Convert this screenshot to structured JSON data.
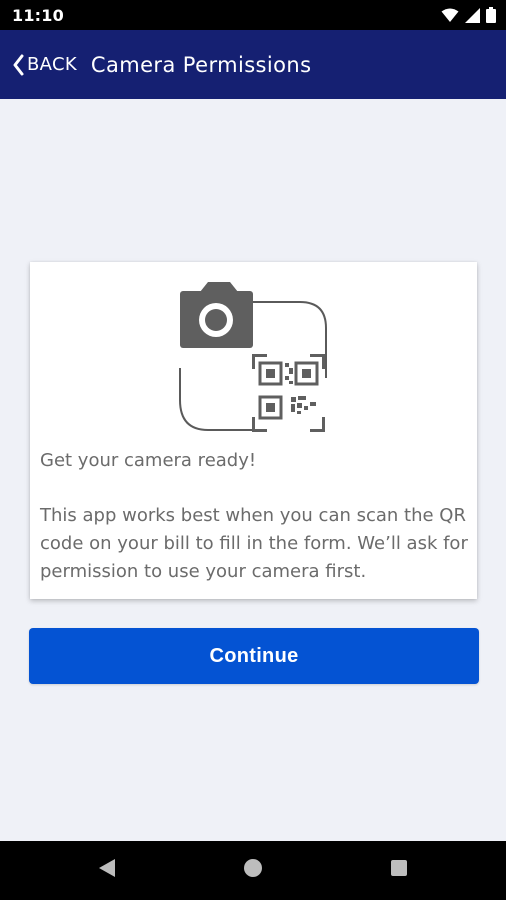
{
  "status_bar": {
    "time": "11:10",
    "icons": [
      "wifi-icon",
      "cellular-signal-icon",
      "battery-icon"
    ]
  },
  "app_bar": {
    "back_label": "BACK",
    "title": "Camera Permissions",
    "background_color": "#152072"
  },
  "card": {
    "illustration": "camera-qr-code-illustration",
    "heading": "Get your camera ready!",
    "body": "This app works best when you can scan the QR code on your bill to fill in the form. We’ll ask for permission to use your camera first."
  },
  "continue_button": {
    "label": "Continue",
    "color": "#0453d3"
  },
  "nav_bar": {
    "icons": [
      "nav-back-icon",
      "nav-home-icon",
      "nav-recents-icon"
    ]
  }
}
